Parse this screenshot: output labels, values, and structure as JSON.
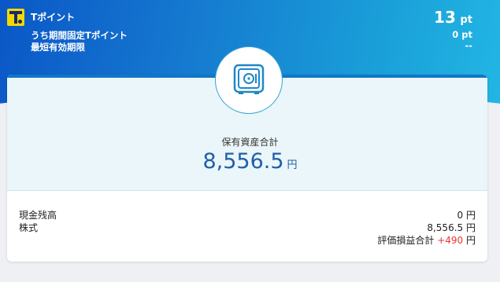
{
  "tpoint": {
    "title": "Tポイント",
    "points_value": "13",
    "points_unit": "pt",
    "partial_label": "うち期間固定Tポイント",
    "partial_value": "0",
    "partial_unit": "pt",
    "expiry_label": "最短有効期限",
    "expiry_value": "--"
  },
  "assets": {
    "total_label": "保有資産合計",
    "total_value": "8,556.5",
    "total_unit": "円",
    "icon": "safe-icon",
    "rows": [
      {
        "label": "現金残高",
        "value": "0",
        "unit": "円"
      },
      {
        "label": "株式",
        "value": "8,556.5",
        "unit": "円"
      }
    ],
    "gain_label": "評価損益合計",
    "gain_value": "+490",
    "gain_unit": "円",
    "gain_color": "#e33333"
  },
  "colors": {
    "accent": "#1276c8",
    "total_text": "#1f5fa8",
    "brand_yellow": "#f5d800"
  }
}
